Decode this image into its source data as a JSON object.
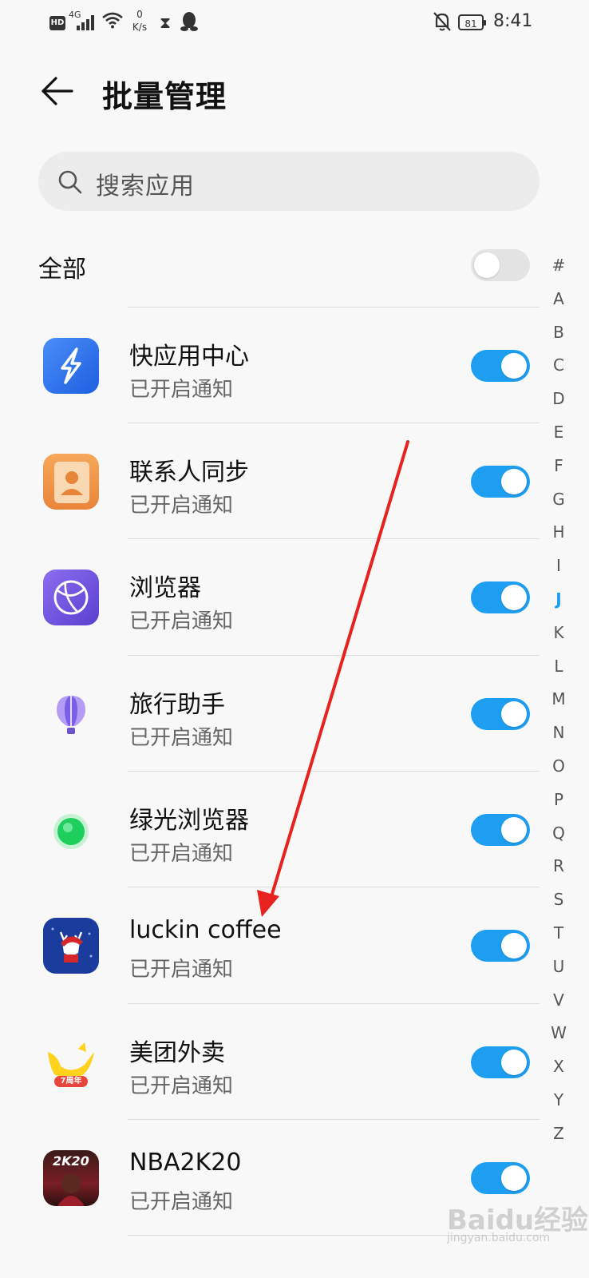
{
  "status_bar": {
    "hd": "HD",
    "network": "4G",
    "speed_value": "0",
    "speed_unit": "K/s",
    "battery": "81",
    "time": "8:41"
  },
  "header": {
    "title": "批量管理"
  },
  "search": {
    "placeholder": "搜索应用"
  },
  "all": {
    "label": "全部",
    "enabled": false
  },
  "apps": [
    {
      "name": "快应用中心",
      "status": "已开启通知",
      "icon": "quick-app-center-icon",
      "enabled": true
    },
    {
      "name": "联系人同步",
      "status": "已开启通知",
      "icon": "contacts-sync-icon",
      "enabled": true
    },
    {
      "name": "浏览器",
      "status": "已开启通知",
      "icon": "browser-icon",
      "enabled": true
    },
    {
      "name": "旅行助手",
      "status": "已开启通知",
      "icon": "travel-assistant-icon",
      "enabled": true
    },
    {
      "name": "绿光浏览器",
      "status": "已开启通知",
      "icon": "green-light-browser-icon",
      "enabled": true
    },
    {
      "name": "luckin coffee",
      "status": "已开启通知",
      "icon": "luckin-coffee-icon",
      "enabled": true
    },
    {
      "name": "美团外卖",
      "status": "已开启通知",
      "icon": "meituan-waimai-icon",
      "enabled": true
    },
    {
      "name": "NBA2K20",
      "status": "已开启通知",
      "icon": "nba2k20-icon",
      "enabled": true
    }
  ],
  "meituan_badge": "7周年",
  "nba_icon_text": "2K20",
  "index": [
    "#",
    "A",
    "B",
    "C",
    "D",
    "E",
    "F",
    "G",
    "H",
    "I",
    "J",
    "K",
    "L",
    "M",
    "N",
    "O",
    "P",
    "Q",
    "R",
    "S",
    "T",
    "U",
    "V",
    "W",
    "X",
    "Y",
    "Z"
  ],
  "index_active": "J",
  "colors": {
    "accent": "#1e9ef0",
    "arrow": "#e8231f",
    "toggle_off": "#e3e3e3"
  },
  "watermark": {
    "brand": "Baidu经验",
    "url": "jingyan.baidu.com"
  }
}
